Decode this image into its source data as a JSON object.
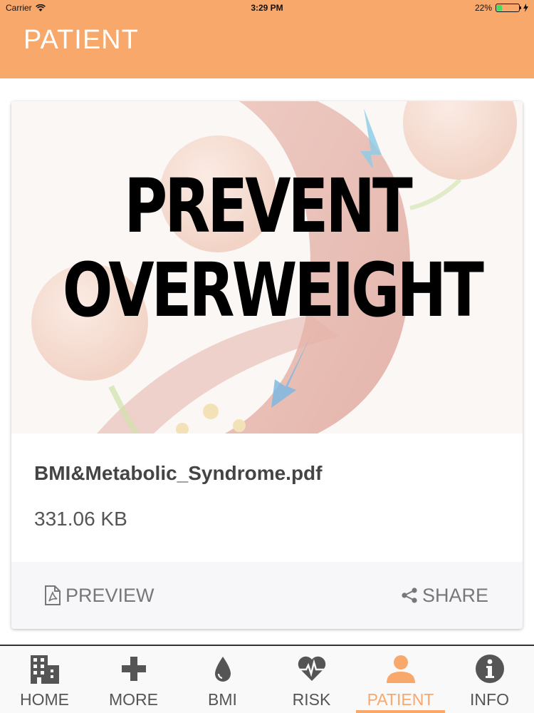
{
  "status_bar": {
    "carrier": "Carrier",
    "time": "3:29 PM",
    "battery_percent": "22%",
    "battery_level": 0.22
  },
  "nav": {
    "title": "PATIENT"
  },
  "document": {
    "image_text_line1": "PREVENT",
    "image_text_line2": "OVERWEIGHT",
    "file_name": "BMI&Metabolic_Syndrome.pdf",
    "file_size": "331.06 KB",
    "preview_label": "PREVIEW",
    "share_label": "SHARE"
  },
  "tabs": [
    {
      "label": "HOME",
      "icon": "building-icon"
    },
    {
      "label": "MORE",
      "icon": "plus-icon"
    },
    {
      "label": "BMI",
      "icon": "drop-icon"
    },
    {
      "label": "RISK",
      "icon": "heartbeat-icon"
    },
    {
      "label": "PATIENT",
      "icon": "user-icon",
      "active": true
    },
    {
      "label": "INFO",
      "icon": "info-icon"
    }
  ],
  "colors": {
    "accent": "#F8A86B",
    "tab_inactive": "#555555"
  }
}
